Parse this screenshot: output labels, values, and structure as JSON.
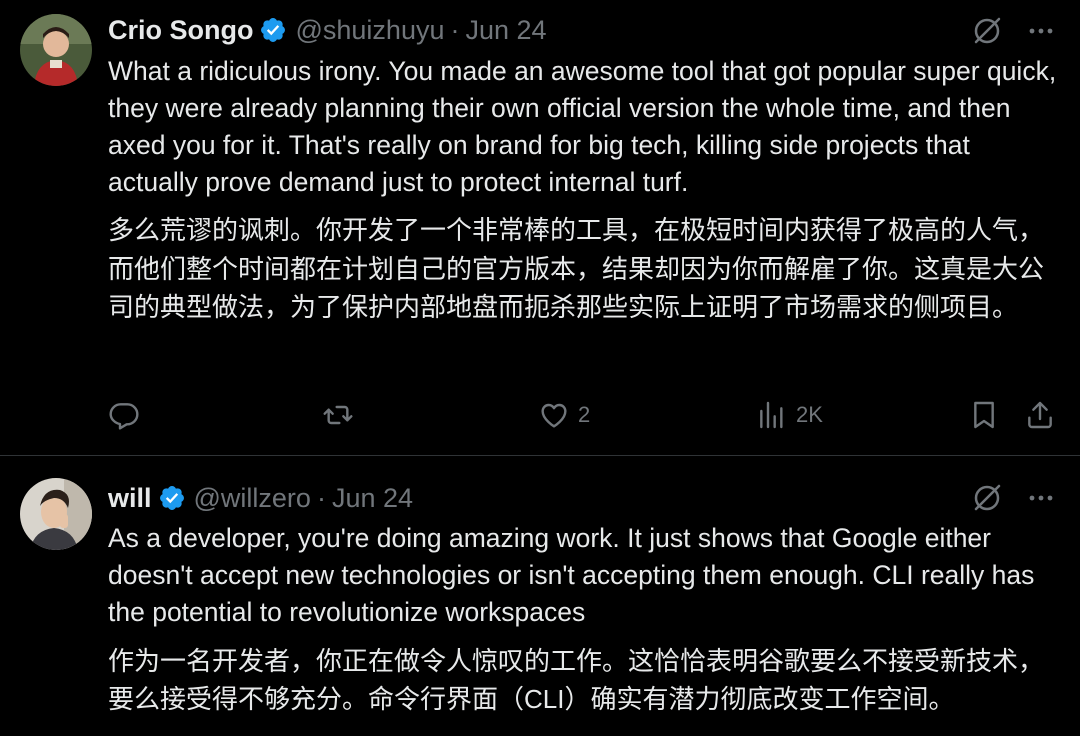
{
  "tweets": [
    {
      "name": "Crio Songo",
      "handle": "@shuizhuyu",
      "separator": "·",
      "date": "Jun 24",
      "text_en": "What a ridiculous irony. You made an awesome tool that got popular super quick, they were already planning their own official version the whole time, and then axed you for it. That's really on brand for big tech, killing side projects that actually prove demand just to protect internal turf.",
      "text_zh": "多么荒谬的讽刺。你开发了一个非常棒的工具，在极短时间内获得了极高的人气，而他们整个时间都在计划自己的官方版本，结果却因为你而解雇了你。这真是大公司的典型做法，为了保护内部地盘而扼杀那些实际上证明了市场需求的侧项目。",
      "likes": "2",
      "views": "2K"
    },
    {
      "name": "will",
      "handle": "@willzero",
      "separator": "·",
      "date": "Jun 24",
      "text_en": "As a developer, you're doing amazing work. It just shows that Google either doesn't accept new technologies or isn't accepting them enough. CLI really has the potential to revolutionize workspaces",
      "text_zh": "作为一名开发者，你正在做令人惊叹的工作。这恰恰表明谷歌要么不接受新技术，要么接受得不够充分。命令行界面（CLI）确实有潜力彻底改变工作空间。"
    }
  ],
  "icons": {
    "verified": "verified-badge-icon",
    "grok": "grok-icon",
    "more": "more-icon",
    "reply": "reply-icon",
    "retweet": "retweet-icon",
    "like": "heart-icon",
    "views": "views-icon",
    "bookmark": "bookmark-icon",
    "share": "share-icon"
  },
  "colors": {
    "background": "#000000",
    "text": "#e7e9ea",
    "muted": "#71767b",
    "verified": "#1d9bf0",
    "divider": "#2f3336"
  }
}
